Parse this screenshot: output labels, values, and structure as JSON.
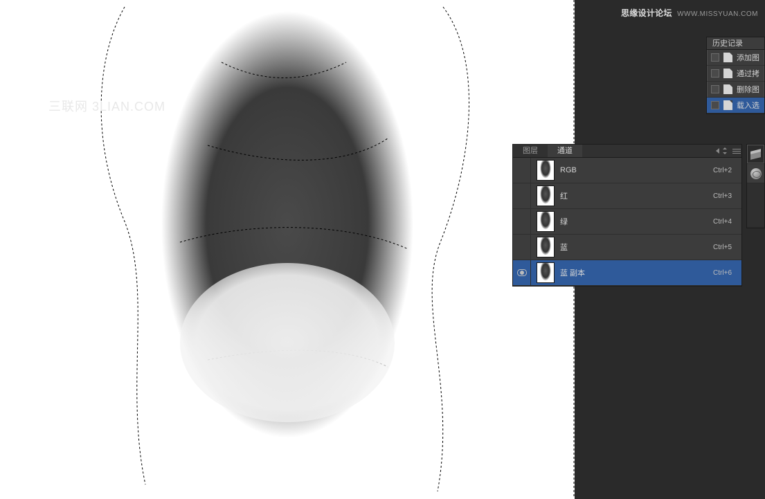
{
  "watermark_left": "三联网 3LIAN.COM",
  "watermark_top_bold": "思缘设计论坛",
  "watermark_top_url": "WWW.MISSYUAN.COM",
  "history": {
    "title": "历史记录",
    "items": [
      {
        "label": "添加图"
      },
      {
        "label": "通过拷"
      },
      {
        "label": "删除图"
      },
      {
        "label": "载入选"
      }
    ]
  },
  "panel_tabs": {
    "layers": "图层",
    "channels": "通道"
  },
  "channels": [
    {
      "name": "RGB",
      "shortcut": "Ctrl+2",
      "selected": false,
      "visible": false
    },
    {
      "name": "红",
      "shortcut": "Ctrl+3",
      "selected": false,
      "visible": false
    },
    {
      "name": "绿",
      "shortcut": "Ctrl+4",
      "selected": false,
      "visible": false
    },
    {
      "name": "蓝",
      "shortcut": "Ctrl+5",
      "selected": false,
      "visible": false
    },
    {
      "name": "蓝 副本",
      "shortcut": "Ctrl+6",
      "selected": true,
      "visible": true
    }
  ]
}
